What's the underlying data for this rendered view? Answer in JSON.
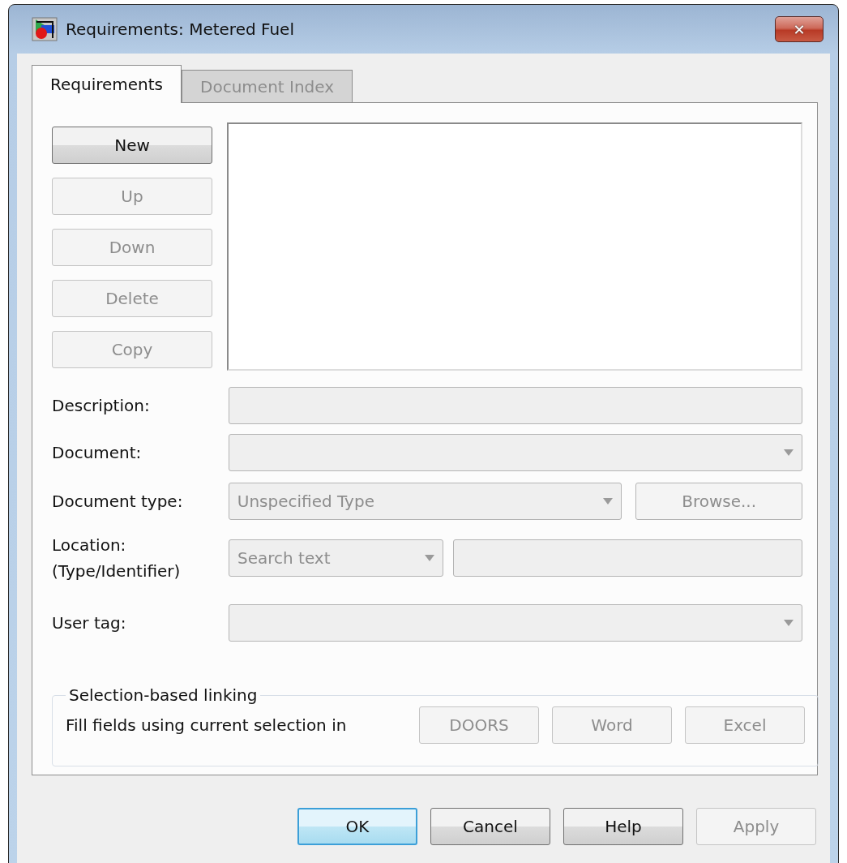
{
  "window": {
    "title": "Requirements: Metered Fuel",
    "close_label": "✕"
  },
  "tabs": [
    {
      "label": "Requirements",
      "selected": true
    },
    {
      "label": "Document Index",
      "selected": false
    }
  ],
  "side_buttons": [
    {
      "label": "New",
      "disabled": false
    },
    {
      "label": "Up",
      "disabled": true
    },
    {
      "label": "Down",
      "disabled": true
    },
    {
      "label": "Delete",
      "disabled": true
    },
    {
      "label": "Copy",
      "disabled": true
    }
  ],
  "fields": [
    {
      "kind": "text",
      "label": "Description:"
    },
    {
      "kind": "combo",
      "label": "Document:"
    },
    {
      "kind": "combo_browse",
      "label": "Document type:",
      "value": "Unspecified Type",
      "button": "Browse..."
    },
    {
      "kind": "location",
      "label": "Location:",
      "label_2": "(Type/Identifier)",
      "value": "Search text"
    },
    {
      "kind": "combo",
      "label": "User tag:"
    }
  ],
  "selection_linking": {
    "title": "Selection-based linking",
    "text": "Fill fields using current selection in",
    "buttons": [
      "DOORS",
      "Word",
      "Excel"
    ]
  },
  "dialog_buttons": [
    {
      "label": "OK",
      "kind": "default"
    },
    {
      "label": "Cancel",
      "kind": "normal"
    },
    {
      "label": "Help",
      "kind": "normal"
    },
    {
      "label": "Apply",
      "kind": "disabled"
    }
  ]
}
